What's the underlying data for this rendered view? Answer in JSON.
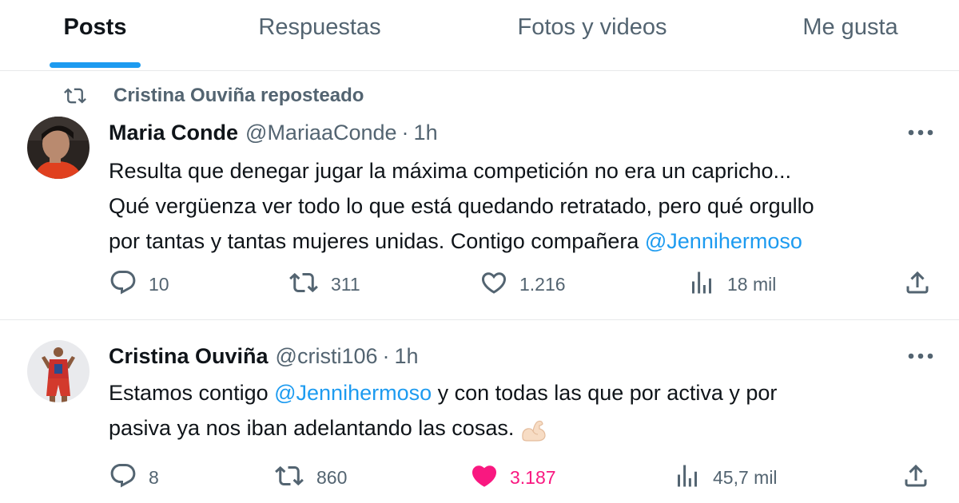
{
  "tabs": [
    {
      "label": "Posts",
      "active": true
    },
    {
      "label": "Respuestas",
      "active": false
    },
    {
      "label": "Fotos y videos",
      "active": false
    },
    {
      "label": "Me gusta",
      "active": false
    }
  ],
  "repost_line": {
    "text": "Cristina Ouviña reposteado",
    "icon": "repost-icon"
  },
  "tweets": [
    {
      "name": "Maria Conde",
      "handle": "@MariaaConde",
      "separator": "·",
      "time": "1h",
      "lines": [
        {
          "text": "Resulta que denegar jugar la máxima competición no era un capricho..."
        },
        {
          "text": "Qué vergüenza ver todo lo que está quedando retratado, pero qué orgullo"
        },
        {
          "pre": "por tantas y tantas mujeres unidas. Contigo compañera ",
          "mention": "@Jennihermoso"
        }
      ],
      "replies": "10",
      "reposts": "311",
      "likes": "1.216",
      "views": "18 mil",
      "liked": false
    },
    {
      "name": "Cristina Ouviña",
      "handle": "@cristi106",
      "separator": "·",
      "time": "1h",
      "lines": [
        {
          "pre": "Estamos contigo ",
          "mention": "@Jennihermoso",
          "post": " y con todas las que por activa y por"
        },
        {
          "text": "pasiva ya nos iban adelantando las cosas.",
          "emoji": "flexed-biceps-emoji"
        }
      ],
      "replies": "8",
      "reposts": "860",
      "likes": "3.187",
      "views": "45,7 mil",
      "liked": true
    }
  ],
  "colors": {
    "accent": "#1d9bf0",
    "like": "#f91880",
    "muted": "#536471",
    "text": "#0f1419",
    "border": "#e7e9ea"
  }
}
